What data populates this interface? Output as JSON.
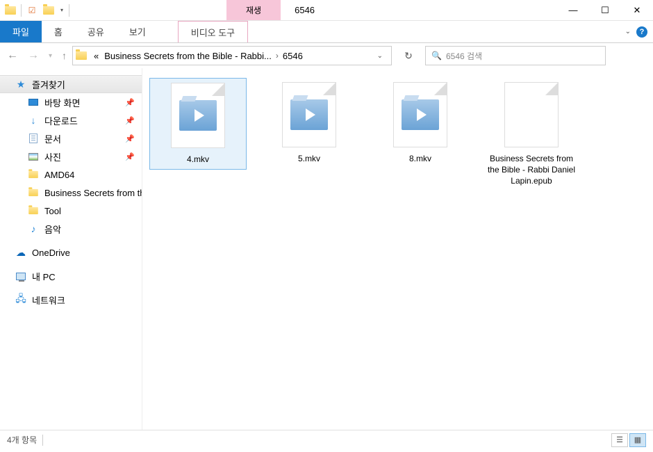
{
  "window": {
    "title": "6546",
    "contextual_tab": "재생"
  },
  "ribbon": {
    "file": "파일",
    "home": "홈",
    "share": "공유",
    "view": "보기",
    "video_tools": "비디오 도구"
  },
  "address": {
    "prefix": "«",
    "crumb1": "Business Secrets from the Bible - Rabbi...",
    "crumb2": "6546"
  },
  "search": {
    "placeholder": "6546 검색"
  },
  "sidebar": {
    "quick_access": "즐겨찾기",
    "desktop": "바탕 화면",
    "downloads": "다운로드",
    "documents": "문서",
    "pictures": "사진",
    "amd64": "AMD64",
    "business": "Business Secrets from the Bible - R",
    "tool": "Tool",
    "music": "음악",
    "onedrive": "OneDrive",
    "this_pc": "내 PC",
    "network": "네트워크"
  },
  "files": [
    {
      "name": "4.mkv",
      "type": "video",
      "selected": true
    },
    {
      "name": "5.mkv",
      "type": "video",
      "selected": false
    },
    {
      "name": "8.mkv",
      "type": "video",
      "selected": false
    },
    {
      "name": "Business Secrets from the Bible - Rabbi Daniel Lapin.epub",
      "type": "doc",
      "selected": false
    }
  ],
  "status": {
    "count": "4개 항목"
  }
}
